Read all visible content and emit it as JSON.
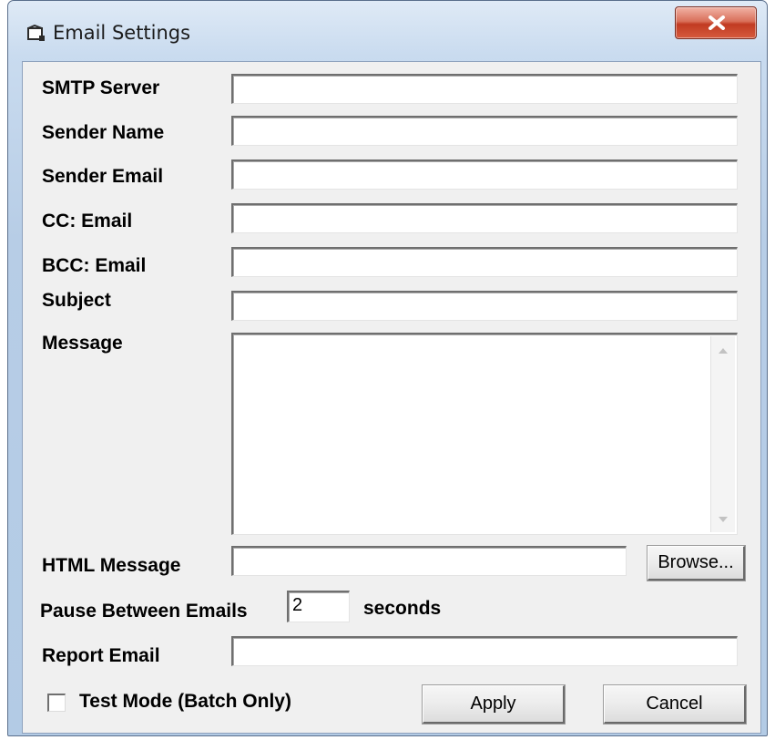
{
  "window": {
    "title": "Email Settings",
    "icon": "window-app-icon",
    "close_icon": "close-x-icon"
  },
  "form": {
    "smtp_server": {
      "label": "SMTP Server",
      "value": ""
    },
    "sender_name": {
      "label": "Sender Name",
      "value": ""
    },
    "sender_email": {
      "label": "Sender Email",
      "value": ""
    },
    "cc_email": {
      "label": "CC: Email",
      "value": ""
    },
    "bcc_email": {
      "label": "BCC: Email",
      "value": ""
    },
    "subject": {
      "label": "Subject",
      "value": ""
    },
    "message": {
      "label": "Message",
      "value": ""
    },
    "html_message": {
      "label": "HTML Message",
      "value": "",
      "browse_label": "Browse..."
    },
    "pause": {
      "label": "Pause Between Emails",
      "value": "2",
      "unit": "seconds"
    },
    "report_email": {
      "label": "Report Email",
      "value": ""
    },
    "test_mode": {
      "label": "Test Mode (Batch Only)",
      "checked": false
    }
  },
  "buttons": {
    "apply": "Apply",
    "cancel": "Cancel"
  },
  "colors": {
    "frame": "#c9dbef",
    "client": "#f0f0f0",
    "close_button": "#c13b22"
  }
}
